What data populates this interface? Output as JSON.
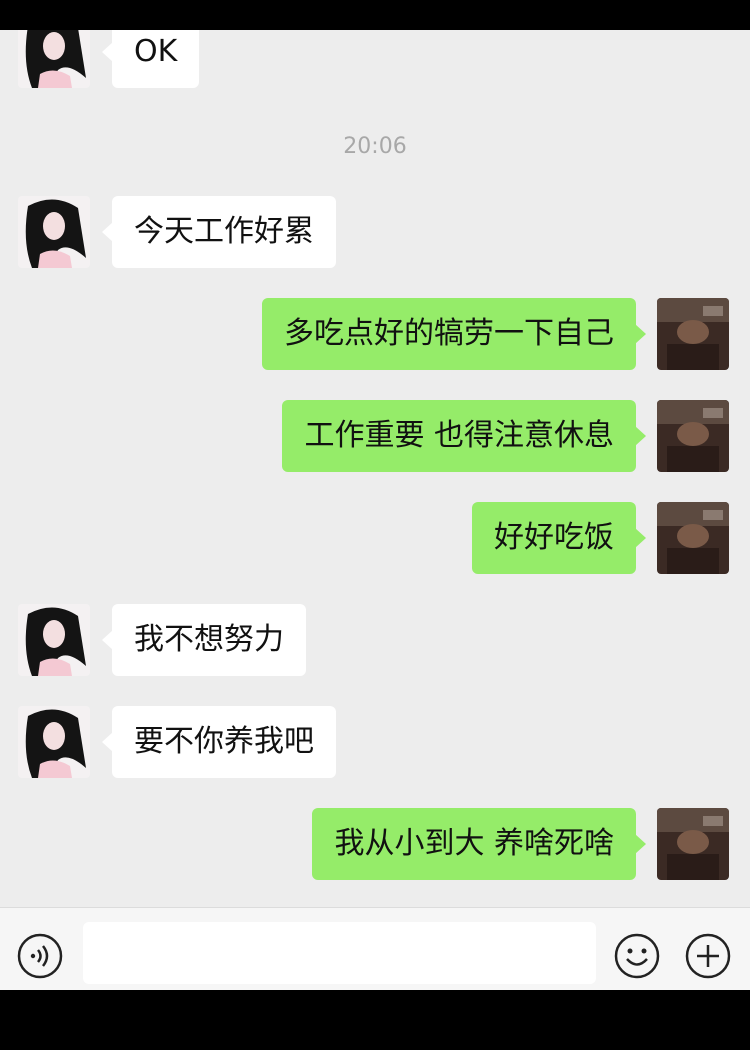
{
  "chat": {
    "timestamp": "20:06",
    "messages": [
      {
        "side": "in",
        "text": "OK"
      },
      {
        "side": "in",
        "text": "今天工作好累"
      },
      {
        "side": "out",
        "text": "多吃点好的犒劳一下自己"
      },
      {
        "side": "out",
        "text": "工作重要 也得注意休息"
      },
      {
        "side": "out",
        "text": "好好吃饭"
      },
      {
        "side": "in",
        "text": "我不想努力"
      },
      {
        "side": "in",
        "text": "要不你养我吧"
      },
      {
        "side": "out",
        "text": "我从小到大 养啥死啥"
      }
    ]
  },
  "input_bar": {
    "icons": [
      "voice-icon",
      "emoji-icon",
      "plus-icon"
    ],
    "text_value": ""
  },
  "colors": {
    "chat_background": "#ededed",
    "incoming_bubble": "#ffffff",
    "outgoing_bubble": "#95ec69"
  }
}
